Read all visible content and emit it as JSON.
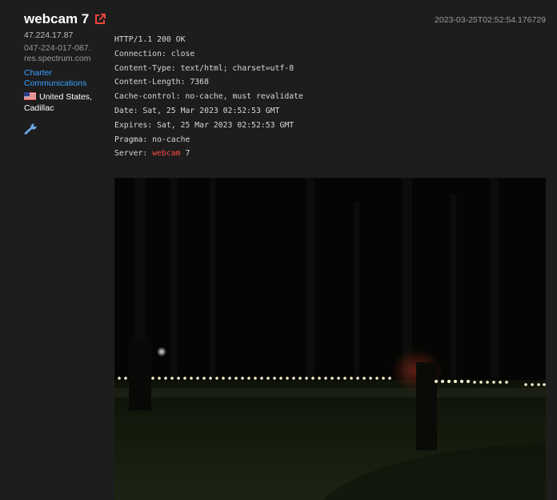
{
  "result": {
    "title": "webcam 7",
    "timestamp": "2023-03-25T02:52:54.176729",
    "ip": "47.224.17.87",
    "hostname": "047-224-017-087.res.spectrum.com",
    "org": "Charter Communications",
    "location": "United States, Cadillac",
    "icons": {
      "external_link": "external-link-icon",
      "flag": "us-flag-icon",
      "wrench": "wrench-icon"
    },
    "colors": {
      "accent_red": "#e8453c",
      "link_blue": "#3aa0ff",
      "background": "#1d1d1d"
    },
    "response": {
      "lines": [
        "HTTP/1.1 200 OK",
        "Connection: close",
        "Content-Type: text/html; charset=utf-8",
        "Content-Length: 7368",
        "Cache-control: no-cache, must revalidate",
        "Date: Sat, 25 Mar 2023 02:52:53 GMT",
        "Expires: Sat, 25 Mar 2023 02:52:53 GMT",
        "Pragma: no-cache"
      ],
      "server_prefix": "Server: ",
      "server_highlight": "webcam",
      "server_suffix": " 7"
    }
  }
}
